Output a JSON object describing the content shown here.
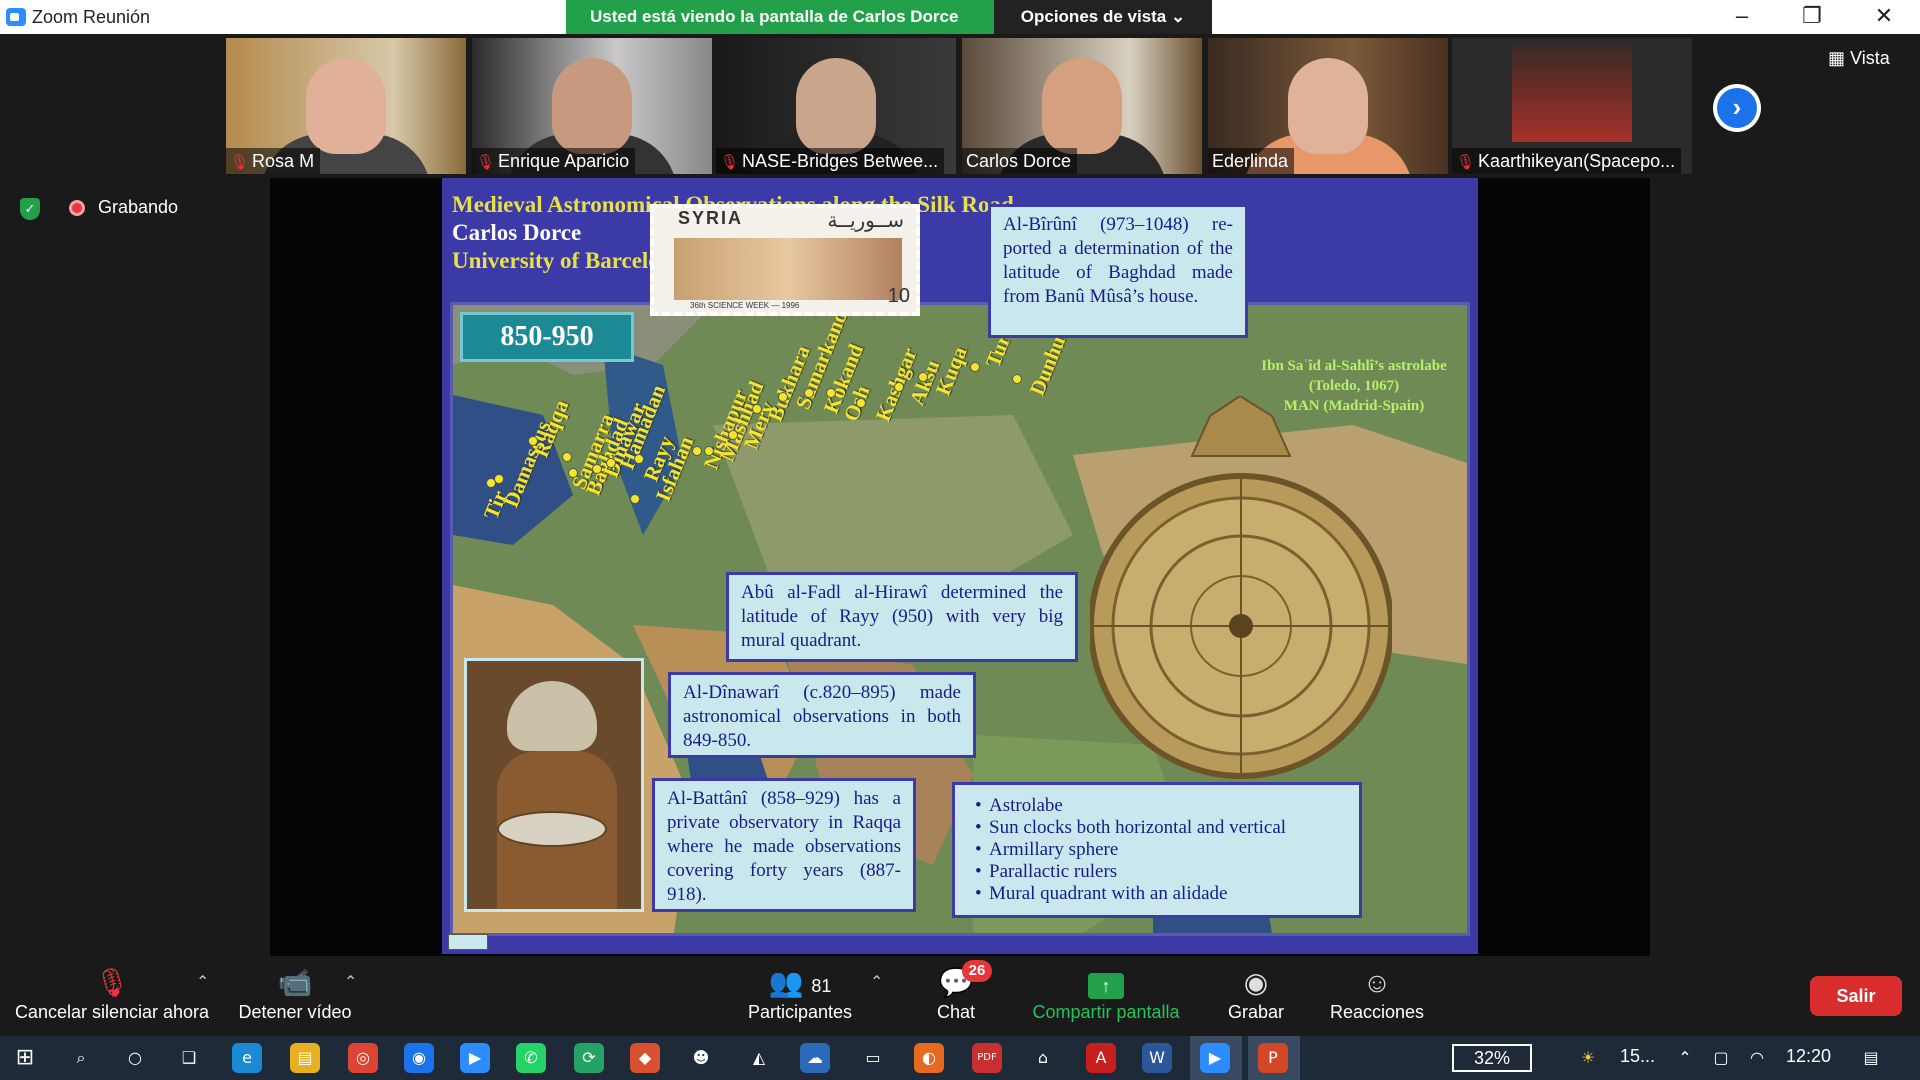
{
  "window": {
    "title": "Zoom Reunión"
  },
  "banner": {
    "sharing": "Usted está viendo la pantalla de Carlos Dorce",
    "view_options": "Opciones de vista ⌄"
  },
  "participants_strip": [
    {
      "name": "Rosa M",
      "muted": true
    },
    {
      "name": "Enrique Aparicio",
      "muted": true
    },
    {
      "name": "NASE-Bridges Betwee...",
      "muted": true
    },
    {
      "name": "Carlos Dorce",
      "muted": false,
      "active": true
    },
    {
      "name": "Ederlinda",
      "muted": false
    },
    {
      "name": "Kaarthikeyan(Spacepo...",
      "muted": true
    }
  ],
  "vista_label": "Vista",
  "recording_label": "Grabando",
  "slide": {
    "header_line1": "Medieval Astronomical Observations along the Silk Road",
    "header_line2": "Carlos Dorce",
    "header_line3": "University of Barcelona",
    "era": "850-950",
    "stamp": {
      "country": "SYRIA",
      "arabic": "ســوريــة",
      "value": "10",
      "caption": "36th SCIENCE WEEK — 1996"
    },
    "biruni": "Al-Bîrûnî (973–1048) re-ported a determination of the latitude of Baghdad made from Banû Mûsâ’s house.",
    "hirawi": "Abû al-Fadl al-Hirawî determined the latitude of Rayy (950) with very big mural quadrant.",
    "dinawari": "Al-Dînawarî (c.820–895) made astronomical observations in both 849-850.",
    "battani": "Al-Battânî (858–929) has a private observatory in Raqqa where he made observations covering forty years (887-918).",
    "instruments": [
      "Astrolabe",
      "Sun clocks both horizontal and vertical",
      "Armillary sphere",
      "Parallactic rulers",
      "Mural quadrant with an alidade"
    ],
    "astrolabe_caption": [
      "Ibn Saʿîd al-Sahlî’s astrolabe",
      "(Toledo, 1067)",
      "MAN (Madrid-Spain)"
    ],
    "cities": [
      "Tir",
      "Damascus",
      "Raqqa",
      "Samarra",
      "Baghdad",
      "Dinawar",
      "Hamadan",
      "Rayy",
      "Isfahan",
      "Nishapur",
      "Mashhad",
      "Merv",
      "Bukhara",
      "Samarkand",
      "Kokand",
      "Osh",
      "Kashgar",
      "Aksu",
      "Kuqa",
      "Turfan",
      "Dunhuang"
    ]
  },
  "controls": {
    "unmute": "Cancelar silenciar ahora",
    "video": "Detener vídeo",
    "participants": "Participantes",
    "participants_count": "81",
    "chat": "Chat",
    "chat_badge": "26",
    "share": "Compartir pantalla",
    "record": "Grabar",
    "reactions": "Reacciones",
    "leave": "Salir"
  },
  "taskbar": {
    "battery": "32%",
    "weather": "15...",
    "time": "12:20"
  }
}
